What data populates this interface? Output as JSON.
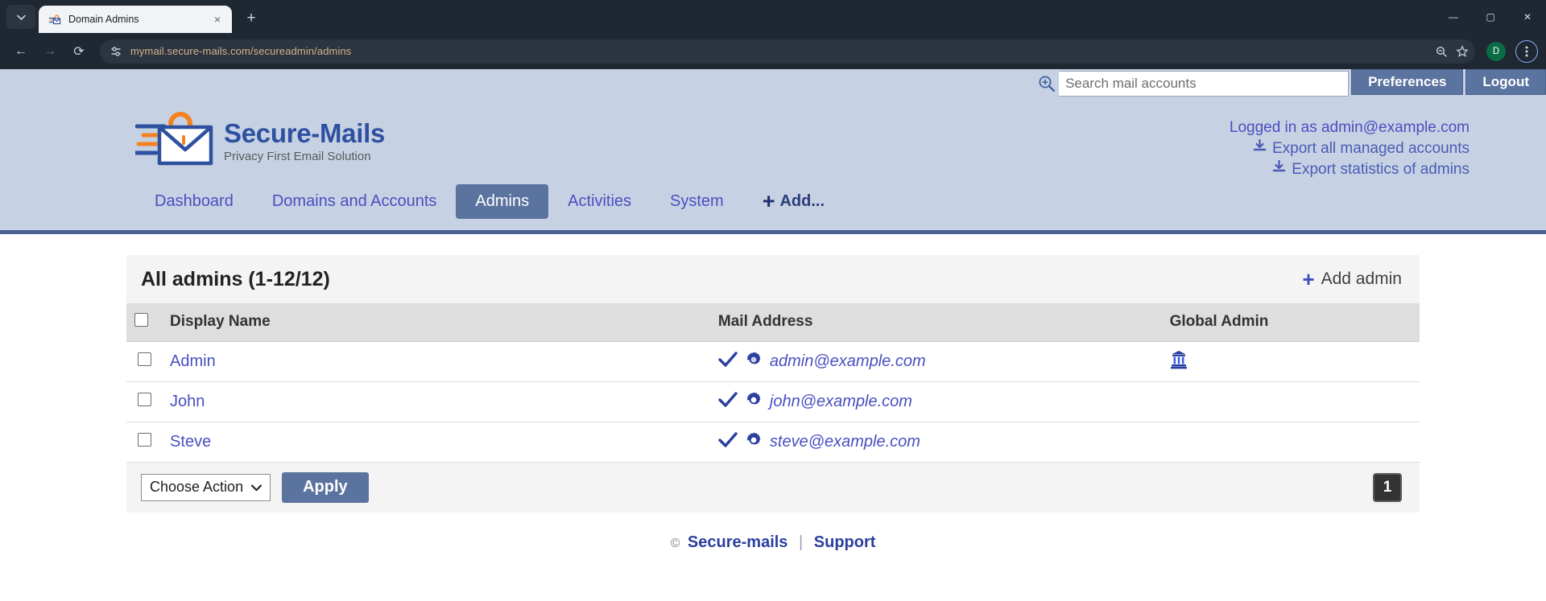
{
  "browser": {
    "tab": {
      "title": "Domain Admins",
      "favicon": "secure-mails-favicon",
      "close": "×"
    },
    "new_tab": "+",
    "tab_list": "▾",
    "window": {
      "minimize": "—",
      "maximize": "▢",
      "close": "✕"
    },
    "nav": {
      "back": "←",
      "forward": "→",
      "reload": "⟳"
    },
    "url": "mymail.secure-mails.com/secureadmin/admins",
    "site_info_icon": "tune-icon",
    "zoom_icon": "search-minus-icon",
    "bookmark_icon": "star-icon",
    "profile_initial": "D",
    "menu_icon": "three-dots-icon"
  },
  "header": {
    "search": {
      "placeholder": "Search mail accounts",
      "value": "",
      "icon": "magnifier-plus-icon"
    },
    "preferences_label": "Preferences",
    "logout_label": "Logout",
    "brand": {
      "name": "Secure-Mails",
      "tagline": "Privacy First Email Solution"
    },
    "account": {
      "logged_in": "Logged in as admin@example.com",
      "export_accounts": "Export all managed accounts",
      "export_statistics": "Export statistics of admins",
      "download_icon": "download-icon"
    },
    "nav_items": [
      {
        "label": "Dashboard",
        "active": false
      },
      {
        "label": "Domains and Accounts",
        "active": false
      },
      {
        "label": "Admins",
        "active": true
      },
      {
        "label": "Activities",
        "active": false
      },
      {
        "label": "System",
        "active": false
      }
    ],
    "add_menu": {
      "label": "Add...",
      "icon": "plus-icon"
    }
  },
  "panel": {
    "title": "All admins (1-12/12)",
    "add_admin": {
      "label": "Add admin",
      "icon": "plus-icon"
    },
    "columns": [
      "Display Name",
      "Mail Address",
      "Global Admin"
    ],
    "rows": [
      {
        "name": "Admin",
        "mail": "admin@example.com",
        "global_admin": true
      },
      {
        "name": "John",
        "mail": "john@example.com",
        "global_admin": false
      },
      {
        "name": "Steve",
        "mail": "steve@example.com",
        "global_admin": false
      }
    ],
    "row_icons": {
      "check": "check-icon",
      "gear": "gear-icon",
      "global": "institution-icon"
    },
    "action_select": {
      "value": "Choose Action",
      "caret": "▼"
    },
    "apply_label": "Apply",
    "pagination": {
      "current": "1"
    }
  },
  "footer": {
    "copyright_symbol": "©",
    "brand_link": "Secure-mails",
    "separator": "|",
    "support_link": "Support"
  },
  "colors": {
    "header_bg": "#c6d2e3",
    "accent_blue": "#5b739f",
    "link_blue": "#4a4fc0",
    "brand_blue": "#2e50a0",
    "brand_orange": "#f58220",
    "rule": "#4a6291"
  }
}
